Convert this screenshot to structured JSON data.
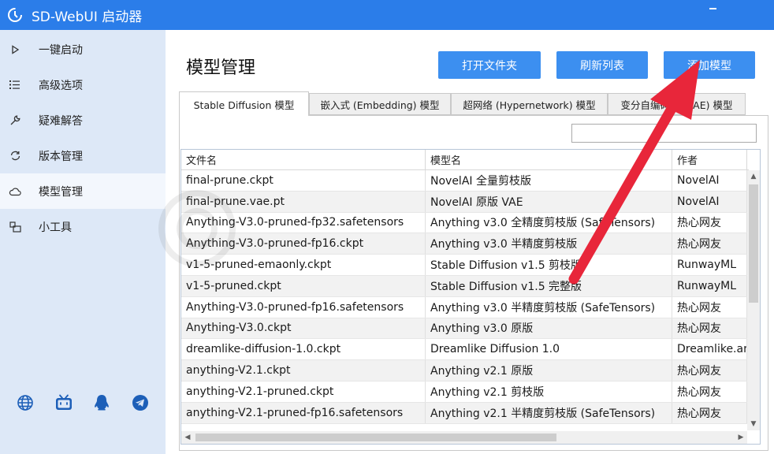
{
  "window": {
    "title": "SD-WebUI 启动器"
  },
  "sidebar": {
    "items": [
      {
        "label": "一键启动",
        "icon": "play-icon"
      },
      {
        "label": "高级选项",
        "icon": "list-icon"
      },
      {
        "label": "疑难解答",
        "icon": "wrench-icon"
      },
      {
        "label": "版本管理",
        "icon": "sync-icon"
      },
      {
        "label": "模型管理",
        "icon": "cloud-icon",
        "active": true
      },
      {
        "label": "小工具",
        "icon": "tools-icon"
      }
    ],
    "footer_icons": [
      "globe-icon",
      "bilibili-icon",
      "qq-icon",
      "telegram-icon"
    ]
  },
  "main": {
    "title": "模型管理",
    "buttons": {
      "open_folder": "打开文件夹",
      "refresh_list": "刷新列表",
      "add_model": "添加模型"
    },
    "tabs": [
      {
        "label": "Stable Diffusion 模型",
        "active": true
      },
      {
        "label": "嵌入式 (Embedding) 模型"
      },
      {
        "label": "超网络 (Hypernetwork) 模型"
      },
      {
        "label": "变分自编码器 (VAE) 模型"
      }
    ],
    "filter": {
      "value": ""
    },
    "table": {
      "headers": [
        "文件名",
        "模型名",
        "作者"
      ],
      "rows": [
        [
          "final-prune.ckpt",
          "NovelAI 全量剪枝版",
          "NovelAI"
        ],
        [
          "final-prune.vae.pt",
          "NovelAI 原版 VAE",
          "NovelAI"
        ],
        [
          "Anything-V3.0-pruned-fp32.safetensors",
          "Anything v3.0 全精度剪枝版 (SafeTensors)",
          "热心网友"
        ],
        [
          "Anything-V3.0-pruned-fp16.ckpt",
          "Anything v3.0 半精度剪枝版",
          "热心网友"
        ],
        [
          "v1-5-pruned-emaonly.ckpt",
          "Stable Diffusion v1.5 剪枝版",
          "RunwayML"
        ],
        [
          "v1-5-pruned.ckpt",
          "Stable Diffusion v1.5 完整版",
          "RunwayML"
        ],
        [
          "Anything-V3.0-pruned-fp16.safetensors",
          "Anything v3.0 半精度剪枝版 (SafeTensors)",
          "热心网友"
        ],
        [
          "Anything-V3.0.ckpt",
          "Anything v3.0 原版",
          "热心网友"
        ],
        [
          "dreamlike-diffusion-1.0.ckpt",
          "Dreamlike Diffusion 1.0",
          "Dreamlike.art"
        ],
        [
          "anything-V2.1.ckpt",
          "Anything v2.1 原版",
          "热心网友"
        ],
        [
          "anything-V2.1-pruned.ckpt",
          "Anything v2.1 剪枝版",
          "热心网友"
        ],
        [
          "anything-V2.1-pruned-fp16.safetensors",
          "Anything v2.1 半精度剪枝版 (SafeTensors)",
          "热心网友"
        ]
      ]
    }
  },
  "colors": {
    "titlebar": "#2b7de9",
    "sidebar": "#dde8f7",
    "button": "#3c8ff0",
    "annotation_arrow": "#e8263a"
  }
}
